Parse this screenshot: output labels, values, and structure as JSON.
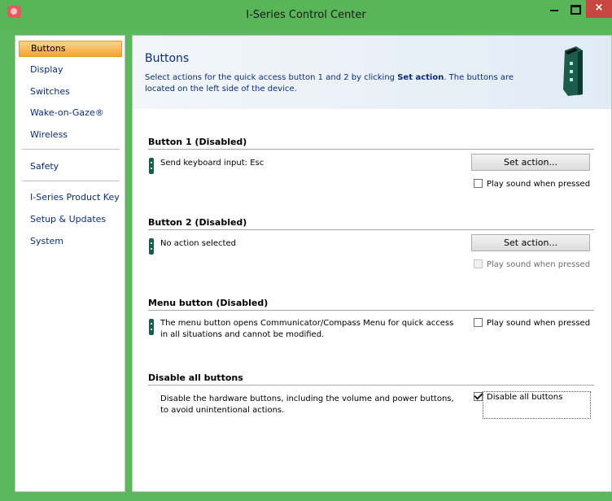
{
  "window": {
    "title": "I-Series Control Center",
    "close_glyph": "×"
  },
  "sidebar": {
    "items": [
      {
        "label": "Buttons"
      },
      {
        "label": "Display"
      },
      {
        "label": "Switches"
      },
      {
        "label": "Wake-on-Gaze®"
      },
      {
        "label": "Wireless"
      },
      {
        "label": "Safety"
      },
      {
        "label": "I-Series Product Key"
      },
      {
        "label": "Setup & Updates"
      },
      {
        "label": "System"
      }
    ]
  },
  "header": {
    "title": "Buttons",
    "desc_pre": "Select actions for the quick access button 1 and 2 by clicking ",
    "desc_bold": "Set action",
    "desc_post": ". The buttons are located on the left side of the device."
  },
  "button1": {
    "title": "Button 1  (Disabled)",
    "action_text": "Send keyboard input: Esc",
    "set_action": "Set action...",
    "sound_label": "Play sound when pressed"
  },
  "button2": {
    "title": "Button 2  (Disabled)",
    "action_text": "No action selected",
    "set_action": "Set action...",
    "sound_label": "Play sound when pressed"
  },
  "menu_button": {
    "title": "Menu button  (Disabled)",
    "desc": "The menu button opens Communicator/Compass Menu for quick access in all situations and cannot be modified.",
    "sound_label": "Play sound when pressed"
  },
  "disable_all": {
    "title": "Disable all buttons",
    "desc": "Disable the hardware buttons, including the volume and power buttons, to avoid unintentional actions.",
    "checkbox_label": "Disable all buttons"
  },
  "colors": {
    "titlebar": "#58b658",
    "accent_link": "#0b2d78",
    "close": "#c7463f",
    "active_nav": "#f3a334"
  }
}
